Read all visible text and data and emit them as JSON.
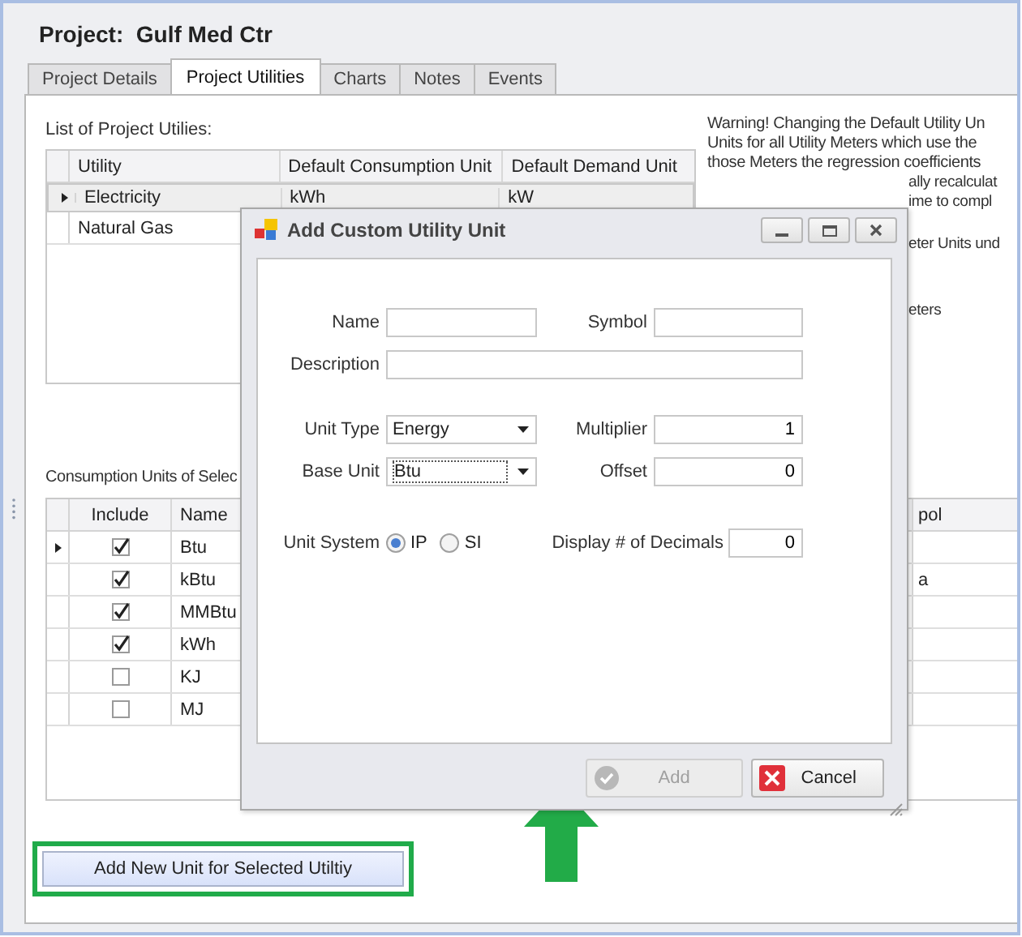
{
  "window": {
    "title": "Project:  Gulf Med Ctr"
  },
  "tabs": [
    {
      "label": "Project Details",
      "selected": false
    },
    {
      "label": "Project Utilities",
      "selected": true
    },
    {
      "label": "Charts",
      "selected": false
    },
    {
      "label": "Notes",
      "selected": false
    },
    {
      "label": "Events",
      "selected": false
    }
  ],
  "utilities": {
    "label": "List of Project Utilies:",
    "columns": [
      "Utility",
      "Default Consumption Unit",
      "Default Demand Unit"
    ],
    "rows": [
      {
        "utility": "Electricity",
        "consumption_unit": "kWh",
        "demand_unit": "kW",
        "selected": true
      },
      {
        "utility": "Natural Gas",
        "selected": false
      }
    ]
  },
  "warning": {
    "lines": [
      "Warning! Changing the Default Utility Un",
      "Units for all Utility Meters which use the",
      "those Meters the regression coefficients"
    ],
    "fragments": [
      "ally recalculat",
      "ime to compl",
      "eter Units und",
      "eters"
    ]
  },
  "consumption_units": {
    "label": "Consumption Units of Selec",
    "columns": [
      "Include",
      "Name"
    ],
    "column_4": "pol",
    "rows": [
      {
        "include": true,
        "name": "Btu",
        "selected": true
      },
      {
        "include": true,
        "name": "kBtu",
        "column_4": "a",
        "selected": false
      },
      {
        "include": true,
        "name": "MMBtu",
        "selected": false
      },
      {
        "include": true,
        "name": "kWh",
        "selected": false
      },
      {
        "include": false,
        "name": "KJ",
        "selected": false
      },
      {
        "include": false,
        "name": "MJ",
        "selected": false
      }
    ]
  },
  "add_unit_button": {
    "label": "Add New Unit for Selected Utiltiy"
  },
  "dialog": {
    "title": "Add Custom Utility Unit",
    "name": {
      "label": "Name"
    },
    "symbol": {
      "label": "Symbol"
    },
    "description": {
      "label": "Description"
    },
    "unit_type": {
      "label": "Unit Type",
      "value": "Energy"
    },
    "multiplier": {
      "label": "Multiplier",
      "value": "1"
    },
    "base_unit": {
      "label": "Base Unit",
      "value": "Btu"
    },
    "offset": {
      "label": "Offset",
      "value": "0"
    },
    "unit_system": {
      "label": "Unit System",
      "options": [
        {
          "label": "IP",
          "selected": true
        },
        {
          "label": "SI",
          "selected": false
        }
      ]
    },
    "decimals": {
      "label": "Display # of Decimals",
      "value": "0"
    },
    "buttons": [
      {
        "label": "Add",
        "kind": "add",
        "disabled": true
      },
      {
        "label": "Cancel",
        "kind": "cancel",
        "disabled": false
      }
    ]
  }
}
